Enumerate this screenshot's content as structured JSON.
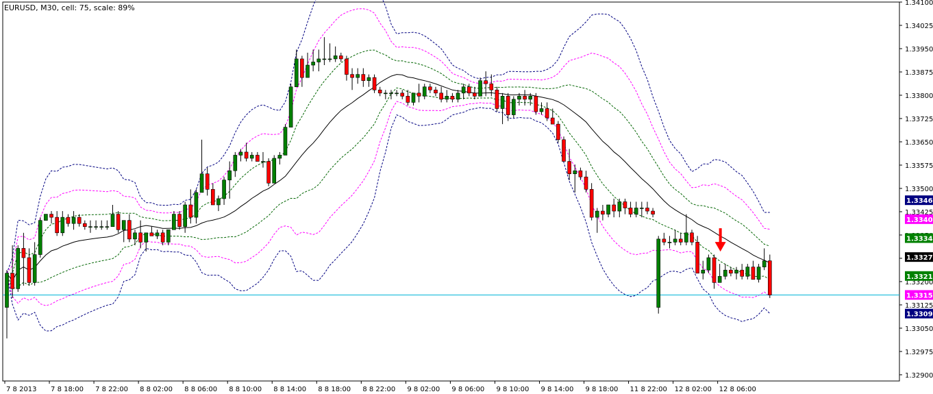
{
  "header": {
    "label": "EURUSD, M30, cell: 75, scale: 89%"
  },
  "colors": {
    "background": "#ffffff",
    "bull": "#008000",
    "bear": "#ff0000",
    "wick": "#000000",
    "sma": "#000000",
    "band_outer": "#000080",
    "band_mid": "#ff00ff",
    "band_inner": "#006400",
    "current_line": "#00b4d8",
    "arrow": "#ff0000"
  },
  "chart_data": {
    "type": "candlestick",
    "symbol": "EURUSD",
    "timeframe": "M30",
    "ylim": [
      1.3288,
      1.341
    ],
    "ytick_values": [
      1.341,
      1.34025,
      1.3395,
      1.33875,
      1.338,
      1.33725,
      1.3365,
      1.33575,
      1.335,
      1.33425,
      1.3335,
      1.33275,
      1.332,
      1.33125,
      1.3305,
      1.32975,
      1.329
    ],
    "ytick_labels": [
      "1.34100",
      "1.34025",
      "1.33950",
      "1.33875",
      "1.33800",
      "1.33725",
      "1.33650",
      "1.33575",
      "1.33500",
      "1.33425",
      "1.33350",
      "1.33275",
      "1.33200",
      "1.33125",
      "1.33050",
      "1.32975",
      "1.32900"
    ],
    "xtick_labels": [
      "7 8 2013",
      "7 8 18:00",
      "7 8 22:00",
      "8 8 02:00",
      "8 8 06:00",
      "8 8 10:00",
      "8 8 14:00",
      "8 8 18:00",
      "8 8 22:00",
      "9 8 02:00",
      "9 8 06:00",
      "9 8 10:00",
      "9 8 14:00",
      "9 8 18:00",
      "11 8 22:00",
      "12 8 02:00",
      "12 8 06:00"
    ],
    "xtick_bar_index": [
      0,
      8,
      16,
      24,
      32,
      40,
      48,
      56,
      64,
      72,
      80,
      88,
      96,
      104,
      112,
      120,
      128
    ],
    "price_badges": [
      {
        "value": 1.33462,
        "label": "1.33462",
        "bg": "#000080",
        "fg": "#ffffff"
      },
      {
        "value": 1.33401,
        "label": "1.33401",
        "bg": "#ff00ff",
        "fg": "#ffffff"
      },
      {
        "value": 1.3334,
        "label": "1.33340",
        "bg": "#008000",
        "fg": "#ffffff"
      },
      {
        "value": 1.33279,
        "label": "1.33279",
        "bg": "#000000",
        "fg": "#ffffff"
      },
      {
        "value": 1.33218,
        "label": "1.33218",
        "bg": "#008000",
        "fg": "#ffffff"
      },
      {
        "value": 1.33157,
        "label": "1.33157",
        "bg": "#ff00ff",
        "fg": "#ffffff"
      },
      {
        "value": 1.33097,
        "label": "1.33097",
        "bg": "#000080",
        "fg": "#ffffff"
      }
    ],
    "current_price": 1.33157,
    "signal_arrow_bar": 128,
    "candles": [
      [
        1.33117,
        1.33237,
        1.33017,
        1.33227
      ],
      [
        1.33227,
        1.33317,
        1.33147,
        1.33177
      ],
      [
        1.33177,
        1.33317,
        1.33167,
        1.33307
      ],
      [
        1.33307,
        1.33357,
        1.33187,
        1.33277
      ],
      [
        1.33277,
        1.33307,
        1.33187,
        1.33197
      ],
      [
        1.33197,
        1.33327,
        1.33187,
        1.33287
      ],
      [
        1.33287,
        1.33407,
        1.33277,
        1.33397
      ],
      [
        1.33397,
        1.33417,
        1.33397,
        1.33417
      ],
      [
        1.33417,
        1.33427,
        1.33387,
        1.33407
      ],
      [
        1.33407,
        1.33427,
        1.33347,
        1.33357
      ],
      [
        1.33357,
        1.33427,
        1.33347,
        1.33407
      ],
      [
        1.33407,
        1.33417,
        1.33377,
        1.33387
      ],
      [
        1.33387,
        1.33427,
        1.33367,
        1.33407
      ],
      [
        1.33407,
        1.33417,
        1.33377,
        1.33387
      ],
      [
        1.33387,
        1.33397,
        1.33367,
        1.33377
      ],
      [
        1.33377,
        1.33397,
        1.33357,
        1.33377
      ],
      [
        1.33377,
        1.33397,
        1.33367,
        1.33377
      ],
      [
        1.33377,
        1.33397,
        1.33367,
        1.33377
      ],
      [
        1.33377,
        1.33397,
        1.33367,
        1.33377
      ],
      [
        1.33377,
        1.33447,
        1.33377,
        1.33417
      ],
      [
        1.33417,
        1.33427,
        1.33357,
        1.33367
      ],
      [
        1.33367,
        1.33397,
        1.33327,
        1.33397
      ],
      [
        1.33397,
        1.33417,
        1.33327,
        1.33337
      ],
      [
        1.33337,
        1.33367,
        1.33317,
        1.33357
      ],
      [
        1.33357,
        1.33397,
        1.33307,
        1.33327
      ],
      [
        1.33327,
        1.33357,
        1.33297,
        1.33357
      ],
      [
        1.33357,
        1.33377,
        1.33347,
        1.33347
      ],
      [
        1.33347,
        1.33367,
        1.33337,
        1.33357
      ],
      [
        1.33357,
        1.33367,
        1.33317,
        1.33327
      ],
      [
        1.33327,
        1.33367,
        1.33317,
        1.33367
      ],
      [
        1.33367,
        1.33427,
        1.33367,
        1.33417
      ],
      [
        1.33417,
        1.33427,
        1.33367,
        1.33377
      ],
      [
        1.33377,
        1.33457,
        1.33357,
        1.33447
      ],
      [
        1.33447,
        1.33497,
        1.33387,
        1.33407
      ],
      [
        1.33407,
        1.33497,
        1.33387,
        1.33487
      ],
      [
        1.33487,
        1.33657,
        1.33487,
        1.33547
      ],
      [
        1.33547,
        1.33567,
        1.33477,
        1.33497
      ],
      [
        1.33497,
        1.33517,
        1.33447,
        1.33447
      ],
      [
        1.33447,
        1.33477,
        1.33427,
        1.33467
      ],
      [
        1.33467,
        1.33537,
        1.33447,
        1.33527
      ],
      [
        1.33527,
        1.33587,
        1.33467,
        1.33557
      ],
      [
        1.33557,
        1.33617,
        1.33537,
        1.33607
      ],
      [
        1.33607,
        1.33627,
        1.33587,
        1.33617
      ],
      [
        1.33617,
        1.33647,
        1.33587,
        1.33597
      ],
      [
        1.33597,
        1.33617,
        1.33587,
        1.33607
      ],
      [
        1.33607,
        1.33617,
        1.33587,
        1.33587
      ],
      [
        1.33587,
        1.33617,
        1.33567,
        1.33587
      ],
      [
        1.33587,
        1.33597,
        1.33507,
        1.33517
      ],
      [
        1.33517,
        1.33607,
        1.33517,
        1.33597
      ],
      [
        1.33597,
        1.33617,
        1.33577,
        1.33607
      ],
      [
        1.33607,
        1.33707,
        1.33607,
        1.33697
      ],
      [
        1.33697,
        1.33837,
        1.33697,
        1.33827
      ],
      [
        1.33827,
        1.33947,
        1.33827,
        1.33917
      ],
      [
        1.33917,
        1.33927,
        1.33827,
        1.33857
      ],
      [
        1.33857,
        1.33937,
        1.33857,
        1.33897
      ],
      [
        1.33897,
        1.33947,
        1.33877,
        1.33907
      ],
      [
        1.33907,
        1.33947,
        1.33877,
        1.33917
      ],
      [
        1.33917,
        1.33987,
        1.33897,
        1.33917
      ],
      [
        1.33917,
        1.33967,
        1.33907,
        1.33917
      ],
      [
        1.33917,
        1.33957,
        1.33907,
        1.33927
      ],
      [
        1.33927,
        1.33937,
        1.33907,
        1.33917
      ],
      [
        1.33917,
        1.33927,
        1.33847,
        1.33867
      ],
      [
        1.33867,
        1.33887,
        1.33817,
        1.33857
      ],
      [
        1.33857,
        1.33887,
        1.33837,
        1.33867
      ],
      [
        1.33867,
        1.33887,
        1.33827,
        1.33847
      ],
      [
        1.33847,
        1.33867,
        1.33827,
        1.33857
      ],
      [
        1.33857,
        1.33867,
        1.33807,
        1.33817
      ],
      [
        1.33817,
        1.33827,
        1.33797,
        1.33807
      ],
      [
        1.33807,
        1.33817,
        1.33787,
        1.33807
      ],
      [
        1.33807,
        1.33817,
        1.33787,
        1.33807
      ],
      [
        1.33807,
        1.33817,
        1.33797,
        1.33807
      ],
      [
        1.33807,
        1.33817,
        1.33787,
        1.33797
      ],
      [
        1.33797,
        1.33817,
        1.33767,
        1.33777
      ],
      [
        1.33777,
        1.33807,
        1.33767,
        1.33807
      ],
      [
        1.33807,
        1.33837,
        1.33777,
        1.33797
      ],
      [
        1.33797,
        1.33837,
        1.33787,
        1.33827
      ],
      [
        1.33827,
        1.33837,
        1.33807,
        1.33817
      ],
      [
        1.33817,
        1.33827,
        1.33797,
        1.33807
      ],
      [
        1.33807,
        1.33827,
        1.33777,
        1.33787
      ],
      [
        1.33787,
        1.33817,
        1.33777,
        1.33797
      ],
      [
        1.33797,
        1.33807,
        1.33777,
        1.33787
      ],
      [
        1.33787,
        1.33817,
        1.33777,
        1.33807
      ],
      [
        1.33807,
        1.33837,
        1.33787,
        1.33827
      ],
      [
        1.33827,
        1.33837,
        1.33797,
        1.33807
      ],
      [
        1.33807,
        1.33827,
        1.33787,
        1.33797
      ],
      [
        1.33797,
        1.33857,
        1.33797,
        1.33847
      ],
      [
        1.33847,
        1.33877,
        1.33797,
        1.33837
      ],
      [
        1.33837,
        1.33867,
        1.33797,
        1.33817
      ],
      [
        1.33817,
        1.33827,
        1.33747,
        1.33757
      ],
      [
        1.33757,
        1.33807,
        1.33707,
        1.33797
      ],
      [
        1.33797,
        1.33807,
        1.33717,
        1.33737
      ],
      [
        1.33737,
        1.33797,
        1.33727,
        1.33787
      ],
      [
        1.33787,
        1.33807,
        1.33767,
        1.33797
      ],
      [
        1.33797,
        1.33817,
        1.33767,
        1.33787
      ],
      [
        1.33787,
        1.33807,
        1.33767,
        1.33797
      ],
      [
        1.33797,
        1.33807,
        1.33737,
        1.33747
      ],
      [
        1.33747,
        1.33777,
        1.33737,
        1.33757
      ],
      [
        1.33757,
        1.33777,
        1.33717,
        1.33727
      ],
      [
        1.33727,
        1.33757,
        1.33707,
        1.33707
      ],
      [
        1.33707,
        1.33717,
        1.33647,
        1.33657
      ],
      [
        1.33657,
        1.33667,
        1.33587,
        1.33587
      ],
      [
        1.33587,
        1.33627,
        1.33527,
        1.33547
      ],
      [
        1.33547,
        1.33577,
        1.33487,
        1.33557
      ],
      [
        1.33557,
        1.33567,
        1.33527,
        1.33537
      ],
      [
        1.33537,
        1.33557,
        1.33487,
        1.33497
      ],
      [
        1.33497,
        1.33517,
        1.33397,
        1.33407
      ],
      [
        1.33407,
        1.33437,
        1.33357,
        1.33427
      ],
      [
        1.33427,
        1.33447,
        1.33397,
        1.33417
      ],
      [
        1.33417,
        1.33447,
        1.33407,
        1.33447
      ],
      [
        1.33447,
        1.33467,
        1.33407,
        1.33427
      ],
      [
        1.33427,
        1.33467,
        1.33407,
        1.33457
      ],
      [
        1.33457,
        1.33467,
        1.33417,
        1.33437
      ],
      [
        1.33437,
        1.33457,
        1.33407,
        1.33417
      ],
      [
        1.33417,
        1.33457,
        1.33407,
        1.33437
      ],
      [
        1.33437,
        1.33457,
        1.33407,
        1.33437
      ],
      [
        1.33437,
        1.33457,
        1.33417,
        1.33427
      ],
      [
        1.33427,
        1.33437,
        1.33407,
        1.33417
      ],
      [
        1.33117,
        1.33347,
        1.33097,
        1.33337
      ],
      [
        1.33337,
        1.33357,
        1.33317,
        1.33327
      ],
      [
        1.33327,
        1.33347,
        1.33307,
        1.33327
      ],
      [
        1.33327,
        1.33367,
        1.33317,
        1.33337
      ],
      [
        1.33337,
        1.33357,
        1.33317,
        1.33327
      ],
      [
        1.33327,
        1.33417,
        1.33317,
        1.33357
      ],
      [
        1.33357,
        1.33367,
        1.33317,
        1.33327
      ],
      [
        1.33327,
        1.33347,
        1.33227,
        1.33227
      ],
      [
        1.33227,
        1.33267,
        1.33207,
        1.33237
      ],
      [
        1.33237,
        1.33287,
        1.33227,
        1.33277
      ],
      [
        1.33277,
        1.33287,
        1.33177,
        1.33197
      ],
      [
        1.33197,
        1.33257,
        1.33197,
        1.33217
      ],
      [
        1.33217,
        1.33257,
        1.33207,
        1.33237
      ],
      [
        1.33237,
        1.33247,
        1.33217,
        1.33227
      ],
      [
        1.33227,
        1.33247,
        1.33207,
        1.33237
      ],
      [
        1.33237,
        1.33257,
        1.33207,
        1.33217
      ],
      [
        1.33217,
        1.33257,
        1.33207,
        1.33247
      ],
      [
        1.33247,
        1.33267,
        1.33217,
        1.33207
      ],
      [
        1.33207,
        1.33257,
        1.33197,
        1.33247
      ],
      [
        1.33247,
        1.33307,
        1.33237,
        1.33267
      ],
      [
        1.33267,
        1.33287,
        1.33147,
        1.33157
      ]
    ]
  }
}
